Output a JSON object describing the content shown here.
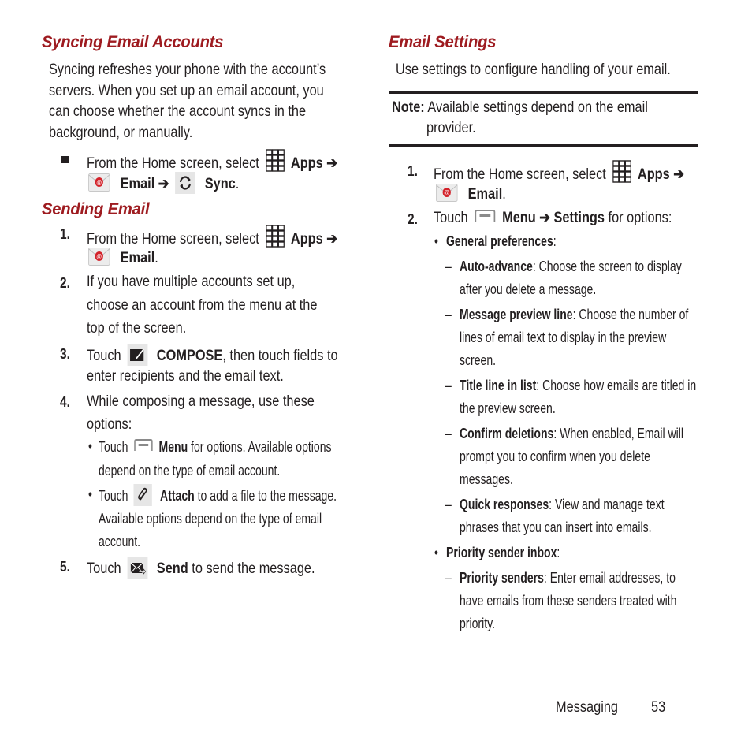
{
  "left": {
    "syncing": {
      "title": "Syncing Email Accounts",
      "para_lines": [
        "Syncing refreshes your phone with the account’s",
        "servers. When you set up an email account, you",
        "can choose whether the account syncs in the",
        "background, or manually."
      ],
      "step": {
        "prefix": "From the Home screen, select",
        "apps": "Apps",
        "arrow": "➔",
        "email": "Email",
        "sync": "Sync",
        "period": "."
      }
    },
    "sending": {
      "title": "Sending Email",
      "steps": [
        {
          "num": "1.",
          "prefix": "From the Home screen, select",
          "apps": "Apps",
          "arrow": "➔",
          "email": "Email",
          "period": "."
        },
        {
          "num": "2.",
          "lines": [
            "If you have multiple accounts set up,",
            "choose an account from the menu at the",
            "top of the screen."
          ]
        },
        {
          "num": "3.",
          "touch": "Touch",
          "bold": "COMPOSE",
          "rest": ", then touch fields to",
          "line2": "enter recipients and the email text."
        },
        {
          "num": "4.",
          "lines": [
            "While composing a message, use these",
            "options:"
          ]
        },
        {
          "num": "5.",
          "touch": "Touch",
          "bold": "Send",
          "rest": " to send the message."
        }
      ],
      "sub_bullets": [
        {
          "touch": "Touch",
          "bold": "Menu",
          "rest": " for options. Available options",
          "line2": "depend on the type of email account."
        },
        {
          "touch": "Touch",
          "bold": "Attach",
          "rest": " to add a file to the message.",
          "line2": "Available options depend on the type of email",
          "line3": "account."
        }
      ]
    }
  },
  "right": {
    "title": "Email Settings",
    "intro": "Use settings to configure handling of your email.",
    "note": {
      "label": "Note:",
      "line1": "Available settings depend on the email",
      "line2": "provider."
    },
    "steps": [
      {
        "num": "1.",
        "prefix": "From the Home screen, select",
        "apps": "Apps",
        "arrow": "➔",
        "email": "Email",
        "period": "."
      },
      {
        "num": "2.",
        "touch": "Touch",
        "menu": "Menu",
        "arrow": "➔",
        "settings": "Settings",
        "rest": " for options:"
      }
    ],
    "groups": [
      {
        "label": "General preferences",
        "items": [
          {
            "name": "Auto-advance",
            "lines": [
              ": Choose the screen to display",
              "after you delete a message."
            ]
          },
          {
            "name": "Message preview line",
            "lines": [
              ": Choose the number of",
              "lines of email text to display in the preview",
              "screen."
            ]
          },
          {
            "name": "Title line in list",
            "lines": [
              ": Choose how emails are titled in",
              "the preview screen."
            ]
          },
          {
            "name": "Confirm deletions",
            "lines": [
              ": When enabled, Email will",
              "prompt you to confirm when you delete",
              "messages."
            ]
          },
          {
            "name": "Quick responses",
            "lines": [
              ": View and manage text",
              "phrases that you can insert into emails."
            ]
          }
        ]
      },
      {
        "label": "Priority sender inbox",
        "items": [
          {
            "name": "Priority senders",
            "lines": [
              ": Enter email addresses, to",
              "have emails from these senders treated with",
              "priority."
            ]
          }
        ]
      }
    ]
  },
  "footer": {
    "section": "Messaging",
    "page": "53"
  },
  "colors": {
    "heading": "#9e1b20",
    "text": "#231f20",
    "icon_bg": "#e6e6e6"
  },
  "glyphs": {
    "dash": "–",
    "bullet": "•",
    "colon": ":"
  }
}
